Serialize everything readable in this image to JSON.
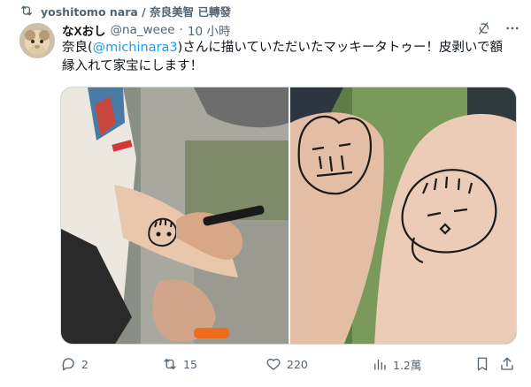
{
  "repost": {
    "text": "yoshitomo nara / 奈良美智 已轉發",
    "icon": "repost-icon"
  },
  "author": {
    "name_prefix": "な",
    "name_x": "X",
    "name_suffix": "おし",
    "handle": "@na_weee",
    "dot": "·",
    "time": "10 小時"
  },
  "header_icons": [
    "grok-icon",
    "more-icon"
  ],
  "tweet": {
    "text_before": "奈良(",
    "mention": "@michinara3",
    "text_after": ")さんに描いていただいたマッキータトゥー！皮剥いで額縁入れて家宝にします！"
  },
  "media": {
    "count": 2
  },
  "actions": {
    "reply": "2",
    "retweet": "15",
    "like": "220",
    "views": "1.2萬"
  },
  "colors": {
    "accent": "#1d9bf0",
    "muted": "#536471",
    "text": "#0f1419",
    "border": "#cfd9de"
  }
}
